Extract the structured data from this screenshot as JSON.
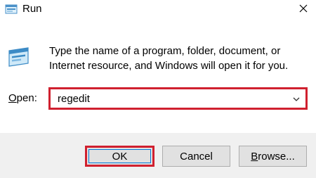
{
  "window": {
    "title": "Run",
    "close_glyph": "✕"
  },
  "body": {
    "description_line1": "Type the name of a program, folder, document, or",
    "description_line2": "Internet resource, and Windows will open it for you.",
    "open_label_accel": "O",
    "open_label_rest": "pen:",
    "open_value": "regedit"
  },
  "buttons": {
    "ok": "OK",
    "cancel": "Cancel",
    "browse_accel": "B",
    "browse_rest": "rowse..."
  },
  "icons": {
    "title": "run-app-icon",
    "run": "run-dialog-icon",
    "close": "close-icon",
    "dropdown": "chevron-down-icon"
  },
  "colors": {
    "highlight": "#d0202f",
    "footer_bg": "#f0f0f0",
    "button_bg": "#e1e1e1",
    "focus": "#0078d7"
  }
}
